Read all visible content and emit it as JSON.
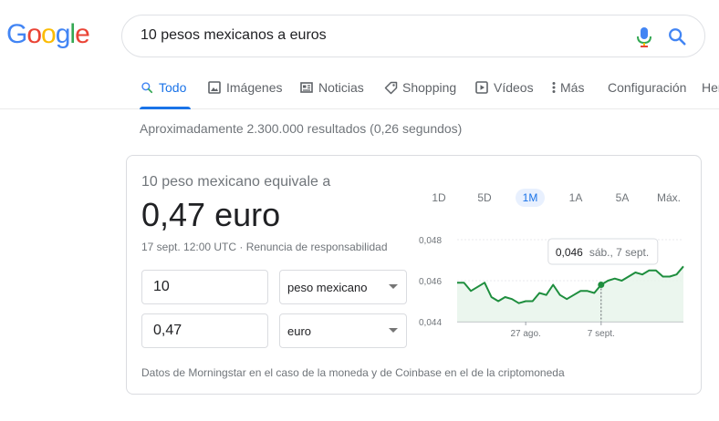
{
  "logo": {
    "letters": [
      "G",
      "o",
      "o",
      "g",
      "l",
      "e"
    ],
    "colors": [
      "#4285f4",
      "#ea4335",
      "#fbbc05",
      "#4285f4",
      "#34a853",
      "#ea4335"
    ]
  },
  "search": {
    "query": "10 pesos mexicanos a euros"
  },
  "tabs": [
    {
      "label": "Todo",
      "icon": "search-icon",
      "active": true
    },
    {
      "label": "Imágenes",
      "icon": "image-icon"
    },
    {
      "label": "Noticias",
      "icon": "news-icon"
    },
    {
      "label": "Shopping",
      "icon": "tag-icon"
    },
    {
      "label": "Vídeos",
      "icon": "play-icon"
    },
    {
      "label": "Más",
      "icon": "more-vert-icon"
    },
    {
      "label": "Configuración"
    },
    {
      "label": "Her"
    }
  ],
  "result_stats": "Aproximadamente 2.300.000 resultados (0,26 segundos)",
  "converter": {
    "equivalence_label": "10 peso mexicano equivale a",
    "result": "0,47 euro",
    "meta": "17 sept. 12:00 UTC · Renuncia de responsabilidad",
    "from_amount": "10",
    "from_currency": "peso mexicano",
    "to_amount": "0,47",
    "to_currency": "euro",
    "ranges": [
      "1D",
      "5D",
      "1M",
      "1A",
      "5A",
      "Máx."
    ],
    "active_range": "1M",
    "footer": "Datos de Morningstar en el caso de la moneda y de Coinbase en el de la criptomoneda"
  },
  "chart_data": {
    "type": "area",
    "y_ticks": [
      "0,048",
      "0,046",
      "0,044"
    ],
    "x_ticks": [
      "27 ago.",
      "7 sept."
    ],
    "ylim": [
      0.044,
      0.048
    ],
    "values": [
      0.0459,
      0.0459,
      0.0455,
      0.0457,
      0.0459,
      0.0452,
      0.045,
      0.0452,
      0.0451,
      0.0449,
      0.045,
      0.045,
      0.0454,
      0.0453,
      0.0458,
      0.0453,
      0.0451,
      0.0453,
      0.0455,
      0.0455,
      0.0454,
      0.0458,
      0.046,
      0.0461,
      0.046,
      0.0462,
      0.0464,
      0.0463,
      0.0465,
      0.0465,
      0.0462,
      0.0462,
      0.0463,
      0.0467
    ],
    "tooltip": {
      "value": "0,046",
      "date": "sáb., 7 sept."
    },
    "colors": {
      "line": "#1e8e3e",
      "fill": "#e6f4ea"
    }
  }
}
